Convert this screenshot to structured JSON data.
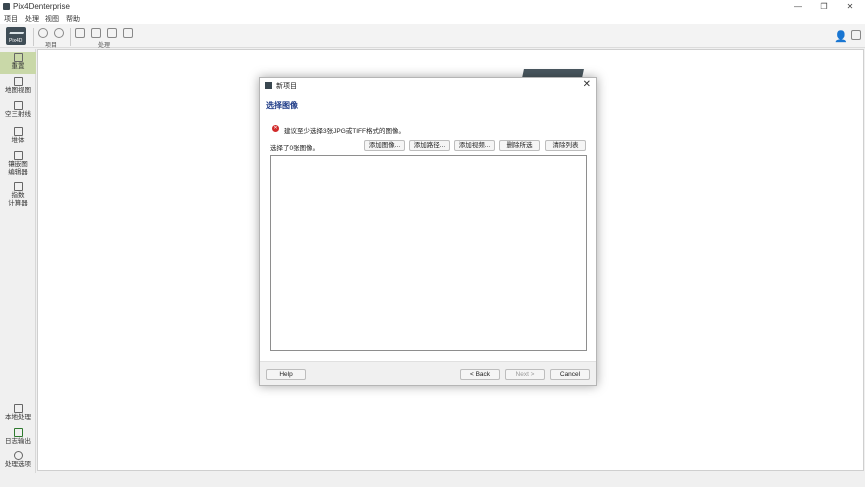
{
  "window": {
    "title": "Pix4Denterprise",
    "controls": {
      "minimize": "—",
      "restore": "❐",
      "close": "✕"
    }
  },
  "menu": [
    "项目",
    "处理",
    "视图",
    "帮助"
  ],
  "logo": {
    "text": "Pix4D"
  },
  "toolbar": {
    "groups": [
      "项目",
      "处理"
    ]
  },
  "sidebar": {
    "top": [
      {
        "label": "重置",
        "icon": "home-icon",
        "active": true
      },
      {
        "label": "地图视图",
        "icon": "map-icon"
      },
      {
        "label": "空三射线",
        "icon": "rays-icon"
      },
      {
        "label": "堆体",
        "icon": "volume-icon"
      },
      {
        "label": "镶嵌图\n编辑器",
        "icon": "mosaic-icon"
      },
      {
        "label": "指数\n计算器",
        "icon": "calculator-icon"
      }
    ],
    "bottom": [
      {
        "label": "本地处理",
        "icon": "local-processing-icon"
      },
      {
        "label": "日志输出",
        "icon": "log-icon"
      },
      {
        "label": "处理选项",
        "icon": "gear-icon"
      }
    ]
  },
  "dialog": {
    "title": "新项目",
    "close": "✕",
    "heading": "选择图像",
    "warning": "建议至少选择3张JPG或TIFF格式的图像。",
    "count_text": "选择了0张图像。",
    "buttons": {
      "add_images": "添加图像...",
      "add_folder": "添加路径...",
      "add_video": "添加视频...",
      "remove_selected": "删除所选",
      "clear_list": "清除列表"
    },
    "footer": {
      "help": "Help",
      "back": "< Back",
      "next": "Next >",
      "cancel": "Cancel"
    }
  },
  "colors": {
    "accent_heading": "#1f3c88",
    "warning": "#d12b2b",
    "active_sidebar": "#c9d8a8"
  }
}
